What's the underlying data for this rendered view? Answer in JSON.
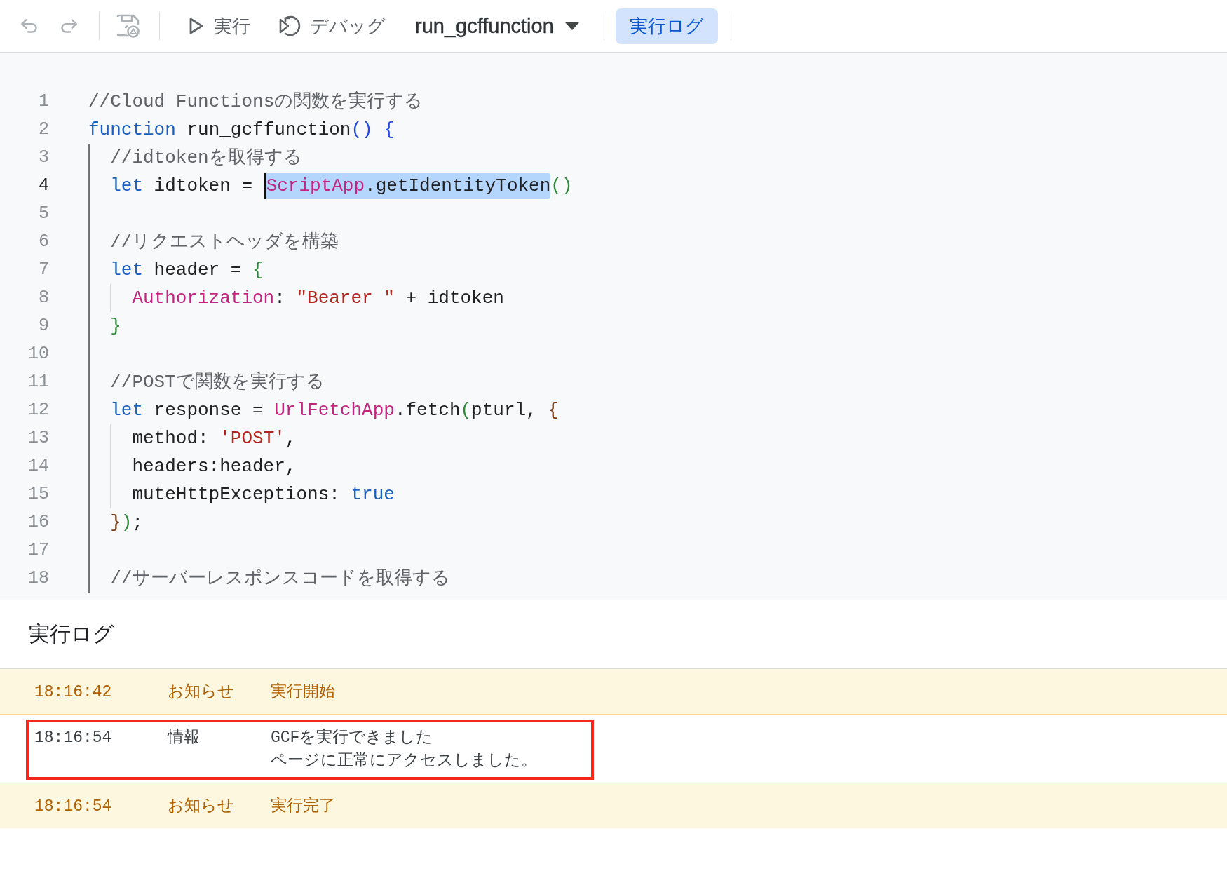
{
  "toolbar": {
    "undo": {
      "disabled": true
    },
    "redo": {
      "disabled": true
    },
    "save": {
      "disabled": true
    },
    "run": {
      "label": "実行"
    },
    "debug": {
      "label": "デバッグ"
    },
    "function_select": {
      "value": "run_gcffunction"
    },
    "log_toggle": {
      "label": "実行ログ",
      "selected": true
    }
  },
  "editor": {
    "lines": [
      {
        "number": "1",
        "current": false,
        "tokens": [
          {
            "kind": "comment",
            "text": "//Cloud Functionsの関数を実行する"
          }
        ]
      },
      {
        "number": "2",
        "current": false,
        "tokens": [
          {
            "kind": "keyword",
            "text": "function"
          },
          {
            "kind": "plain",
            "text": " run_gcffunction"
          },
          {
            "kind": "bracket1",
            "text": "()"
          },
          {
            "kind": "bracket1",
            "text": " {"
          }
        ],
        "children": [
          {
            "number": "3",
            "current": false,
            "tokens": [
              {
                "kind": "comment",
                "text": "//idtokenを取得する"
              }
            ]
          },
          {
            "number": "4",
            "current": true,
            "tokens": [
              {
                "kind": "keyword",
                "text": "let",
                "selected": false
              },
              {
                "kind": "plain",
                "text": " idtoken = ",
                "selected": false
              },
              {
                "kind": "builtin",
                "text": "ScriptApp",
                "selected": true
              },
              {
                "kind": "plain",
                "text": ".getIdentityToken",
                "selected": true
              },
              {
                "kind": "bracket2",
                "text": "()",
                "selected": false
              }
            ]
          },
          {
            "number": "5",
            "current": false
          },
          {
            "number": "6",
            "current": false,
            "tokens": [
              {
                "kind": "comment",
                "text": "//リクエストヘッダを構築"
              }
            ]
          },
          {
            "number": "7",
            "current": false,
            "tokens": [
              {
                "kind": "keyword",
                "text": "let"
              },
              {
                "kind": "plain",
                "text": " header = "
              },
              {
                "kind": "bracket2",
                "text": "{"
              }
            ],
            "children": [
              {
                "number": "8",
                "current": false,
                "tokens": [
                  {
                    "kind": "builtin",
                    "text": "Authorization"
                  },
                  {
                    "kind": "plain",
                    "text": ": "
                  },
                  {
                    "kind": "string",
                    "text": "\"Bearer \""
                  },
                  {
                    "kind": "plain",
                    "text": " + idtoken"
                  }
                ]
              }
            ]
          },
          {
            "number": "9",
            "current": false,
            "tokens": [
              {
                "kind": "bracket2",
                "text": "}"
              }
            ]
          },
          {
            "number": "10",
            "current": false
          },
          {
            "number": "11",
            "current": false,
            "tokens": [
              {
                "kind": "comment",
                "text": "//POSTで関数を実行する"
              }
            ]
          },
          {
            "number": "12",
            "current": false,
            "tokens": [
              {
                "kind": "keyword",
                "text": "let"
              },
              {
                "kind": "plain",
                "text": " response = "
              },
              {
                "kind": "builtin",
                "text": "UrlFetchApp"
              },
              {
                "kind": "plain",
                "text": ".fetch"
              },
              {
                "kind": "bracket2",
                "text": "("
              },
              {
                "kind": "plain",
                "text": "pturl, "
              },
              {
                "kind": "bracket3",
                "text": "{"
              }
            ],
            "children": [
              {
                "number": "13",
                "current": false,
                "tokens": [
                  {
                    "kind": "plain",
                    "text": "method: "
                  },
                  {
                    "kind": "string",
                    "text": "'POST'"
                  },
                  {
                    "kind": "plain",
                    "text": ","
                  }
                ]
              },
              {
                "number": "14",
                "current": false,
                "tokens": [
                  {
                    "kind": "plain",
                    "text": "headers:header,"
                  }
                ]
              },
              {
                "number": "15",
                "current": false,
                "tokens": [
                  {
                    "kind": "plain",
                    "text": "muteHttpExceptions: "
                  },
                  {
                    "kind": "keyword",
                    "text": "true"
                  }
                ]
              }
            ]
          },
          {
            "number": "16",
            "current": false,
            "tokens": [
              {
                "kind": "bracket3",
                "text": "}"
              },
              {
                "kind": "bracket2",
                "text": ")"
              },
              {
                "kind": "plain",
                "text": ";"
              }
            ]
          },
          {
            "number": "17",
            "current": false
          },
          {
            "number": "18",
            "current": false,
            "tokens": [
              {
                "kind": "comment",
                "text": "//サーバーレスポンスコードを取得する"
              }
            ]
          }
        ]
      }
    ]
  },
  "log": {
    "title": "実行ログ",
    "entries": [
      {
        "kind": "notice",
        "highlighted": false,
        "time": "18:16:42",
        "type": "お知らせ",
        "message_lines": [
          "実行開始"
        ]
      },
      {
        "kind": "info",
        "highlighted": true,
        "time": "18:16:54",
        "type": "情報",
        "message_lines": [
          "GCFを実行できました",
          "ページに正常にアクセスしました。"
        ]
      },
      {
        "kind": "notice",
        "highlighted": false,
        "time": "18:16:54",
        "type": "お知らせ",
        "message_lines": [
          "実行完了"
        ]
      }
    ]
  }
}
